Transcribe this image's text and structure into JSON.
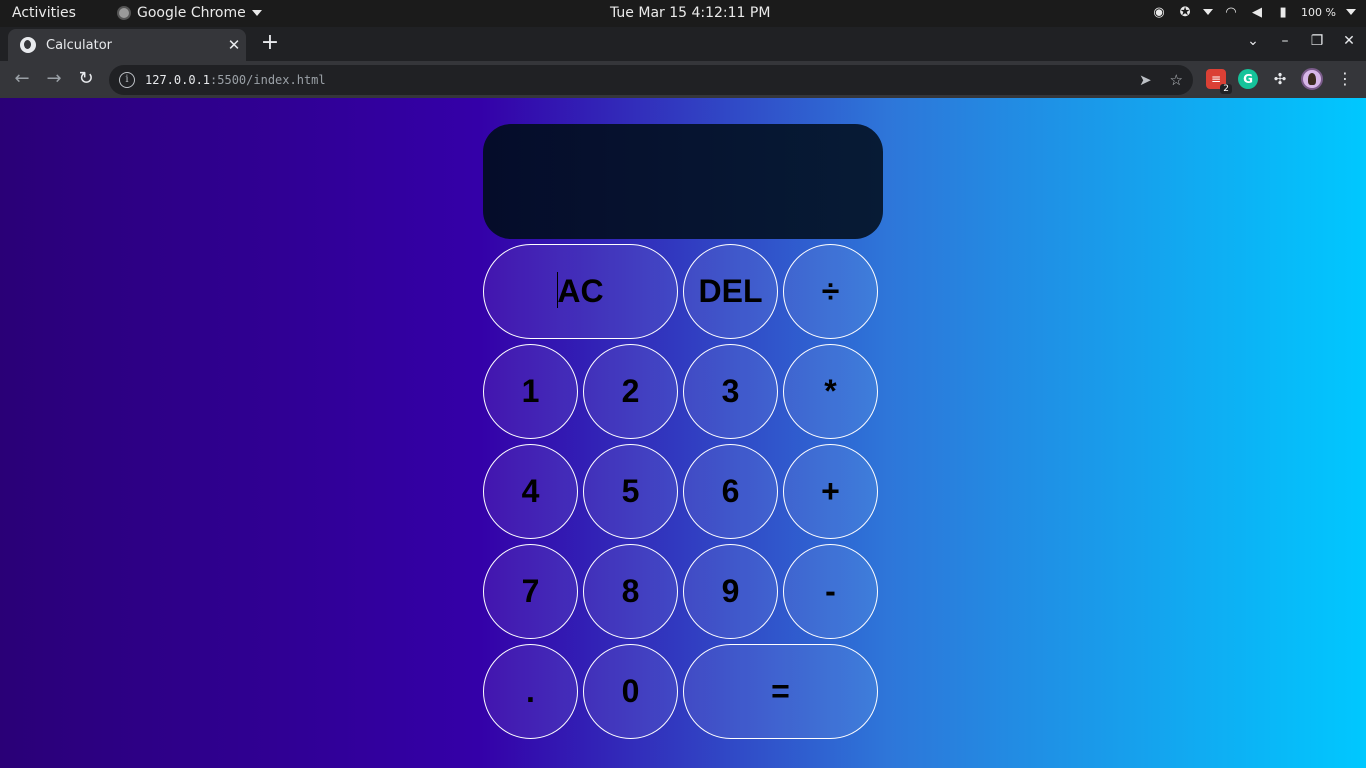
{
  "topbar": {
    "activities": "Activities",
    "app_name": "Google Chrome",
    "clock": "Tue Mar 15  4:12:11 PM",
    "battery": "100 %"
  },
  "browser": {
    "tab_title": "Calculator",
    "url_host": "127.0.0.1",
    "url_rest": ":5500/index.html",
    "extension_badge": "2",
    "extension_grammarly": "G"
  },
  "calculator": {
    "display_value": "",
    "keys": [
      {
        "label": "AC"
      },
      {
        "label": "DEL"
      },
      {
        "label": "÷"
      },
      {
        "label": "1"
      },
      {
        "label": "2"
      },
      {
        "label": "3"
      },
      {
        "label": "*"
      },
      {
        "label": "4"
      },
      {
        "label": "5"
      },
      {
        "label": "6"
      },
      {
        "label": "+"
      },
      {
        "label": "7"
      },
      {
        "label": "8"
      },
      {
        "label": "9"
      },
      {
        "label": "-"
      },
      {
        "label": "."
      },
      {
        "label": "0"
      },
      {
        "label": "="
      }
    ]
  },
  "colors": {
    "gradient_left": "#2a0077",
    "gradient_mid": "#3400a8",
    "gradient_right": "#00c8ff",
    "display_bg": "#050c2a"
  }
}
